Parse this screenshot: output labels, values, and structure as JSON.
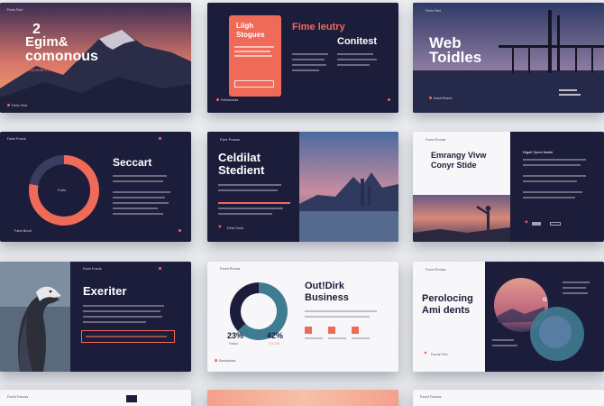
{
  "colors": {
    "navy": "#1b1d3a",
    "coral": "#f06a5a",
    "teal": "#3f7c92",
    "sky": "#6c86b2"
  },
  "slides": {
    "s1": {
      "title_line1": "2",
      "title_line2": "Egim&",
      "title_line3": "comonous",
      "subtitle": "Tanjandent Summary",
      "footer": "Fedo Fact",
      "tag": "Fedo Fact"
    },
    "s2": {
      "card_line1": "Liigh",
      "card_line2": "Stogues",
      "title_line1": "Fime leutry",
      "title_line2": "Conitest",
      "footer": "Fellwhanks",
      "tag": ""
    },
    "s3": {
      "title_line1": "Web",
      "title_line2": "Toidles",
      "footer": "Dash Brand",
      "tag": "Fedo Fact"
    },
    "s4": {
      "title": "Seccart",
      "donut_center": "Fado",
      "tag": "Fadd Fracts",
      "footer": "Fahd Boud"
    },
    "s5": {
      "title_line1": "Celdilat",
      "title_line2": "Stedient",
      "tag": "Fdee Prause",
      "footer": "Deta Dook"
    },
    "s6": {
      "title_line1": "Emrangy Vivw",
      "title_line2": "Conyr Stide",
      "right_title": "Diguti Syres feside",
      "tag": "Fomd Rociss"
    },
    "s7": {
      "title": "Exeriter",
      "tag": "Fadd Fracts"
    },
    "s8": {
      "title_line1": "Out!Dirk",
      "title_line2": "Business",
      "stat1": "23%",
      "stat2": "42%",
      "stat1_label": "Fanlod",
      "stat2_label": "FOCSIR",
      "tag": "Fomd Rociss",
      "footer": "Sanitoload"
    },
    "s9": {
      "title_line1": "Perolocing",
      "title_line2": "Ami dents",
      "footer": "Foune Fint",
      "tag": "Fomd Rociss",
      "circle_letter": "G"
    }
  },
  "chart_data": [
    {
      "type": "pie",
      "title": "",
      "slide": "s4",
      "values": [
        78,
        22
      ],
      "center_label": "Fado"
    },
    {
      "type": "pie",
      "title": "",
      "slide": "s8",
      "values": [
        63,
        37
      ]
    }
  ]
}
